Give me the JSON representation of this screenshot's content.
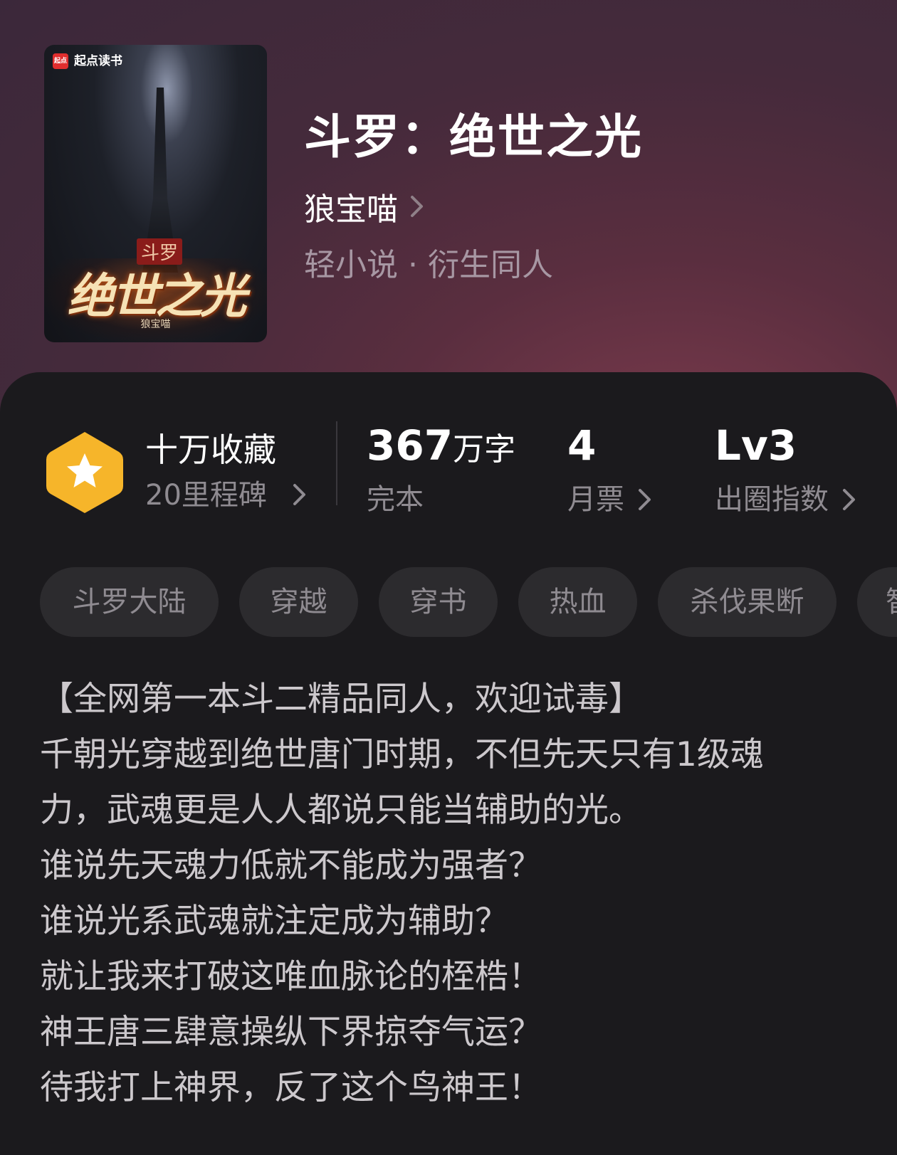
{
  "cover": {
    "publisher_mark": "起点",
    "publisher": "起点读书",
    "series": "斗罗",
    "title": "绝世之光",
    "author": "狼宝喵"
  },
  "book": {
    "title": "斗罗：绝世之光",
    "author": "狼宝喵",
    "genre": "轻小说 · 衍生同人"
  },
  "stats": {
    "favorites_title": "十万收藏",
    "milestones": "20里程碑",
    "word_count_number": "367",
    "word_count_unit": "万字",
    "status": "完本",
    "monthly_tickets": "4",
    "monthly_tickets_label": "月票",
    "circle_level": "Lv3",
    "circle_label": "出圈指数"
  },
  "tags": [
    "斗罗大陆",
    "穿越",
    "穿书",
    "热血",
    "杀伐果断",
    "智"
  ],
  "intro_lines": [
    "【全网第一本斗二精品同人，欢迎试毒】",
    "千朝光穿越到绝世唐门时期，不但先天只有1级魂",
    "力，武魂更是人人都说只能当辅助的光。",
    "谁说先天魂力低就不能成为强者？",
    "谁说光系武魂就注定成为辅助？",
    "就让我来打破这唯血脉论的桎梏！",
    "神王唐三肆意操纵下界掠夺气运？",
    "待我打上神界，反了这个鸟神王！"
  ],
  "colors": {
    "medal": "#f6b52a",
    "panel_bg": "#1b1a1d",
    "tag_bg": "#2c2b2e"
  }
}
